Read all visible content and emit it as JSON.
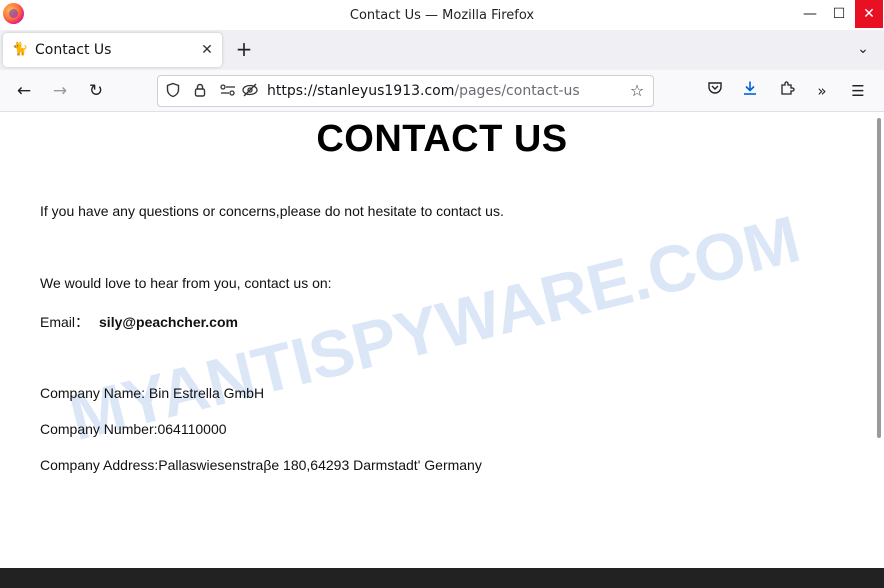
{
  "window": {
    "title": "Contact Us — Mozilla Firefox",
    "minimize": "—",
    "maximize": "☐",
    "close": "✕"
  },
  "tabs": [
    {
      "label": "Contact Us",
      "favicon": "🐈",
      "close": "✕"
    }
  ],
  "tabbar": {
    "new_tab": "+",
    "list_all": "⌄"
  },
  "nav": {
    "back": "←",
    "forward": "→",
    "reload": "↻",
    "url_host": "https://stanleyus1913.com",
    "url_path": "/pages/contact-us",
    "icons": {
      "shield": "shield-icon",
      "lock": "lock-icon",
      "permissions": "permissions-icon",
      "tracking": "tracking-protection-icon",
      "bookmark": "star-icon",
      "pocket": "pocket-icon",
      "download": "download-icon",
      "extensions": "extensions-icon",
      "overflow": "chevron-double-right-icon",
      "menu": "hamburger-menu-icon"
    }
  },
  "page": {
    "heading": "CONTACT US",
    "intro": "If you have any questions or concerns,please do not hesitate to contact us.",
    "love": "We would love to hear from you, contact us on:",
    "email_label": "Email：",
    "email": "sily@peachcher.com",
    "company_name": "Company Name: Bin Estrella GmbH",
    "company_number": "Company Number:064110000",
    "company_address": "Company Address:Pallaswiesenstraβe 180,64293 Darmstadt' Germany"
  },
  "watermark": "MYANTISPYWARE.COM",
  "colors": {
    "close_button": "#e81123",
    "download_icon": "#0060df",
    "watermark": "#cfe0f5"
  }
}
